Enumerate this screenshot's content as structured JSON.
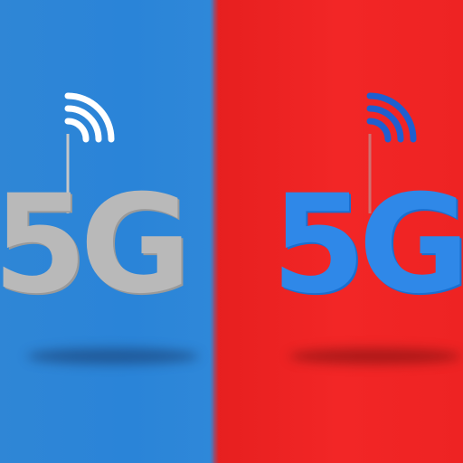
{
  "scene": {
    "left_panel": {
      "color": "#2f86d6",
      "logo_text": "5G",
      "logo_color": "#b9b9b9",
      "antenna_color": "#ffffff"
    },
    "right_panel": {
      "color": "#ee2323",
      "logo_text": "5G",
      "logo_color": "#2f88e8",
      "antenna_color": "#1f5fd0"
    }
  }
}
